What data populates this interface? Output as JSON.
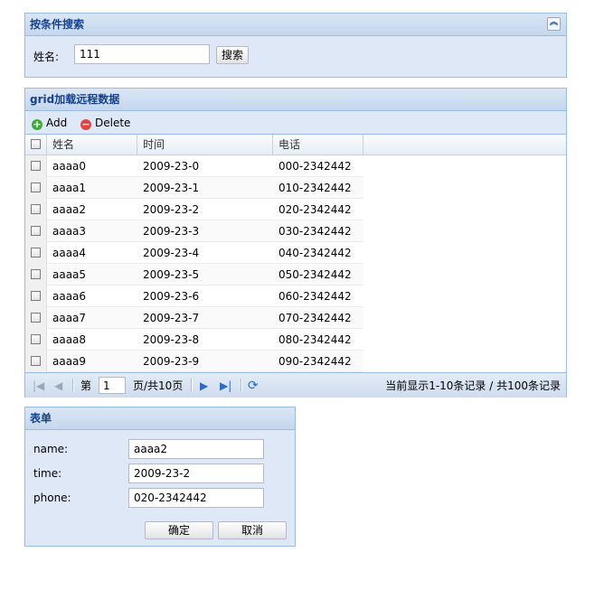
{
  "search_panel": {
    "title": "按条件搜索",
    "name_label": "姓名:",
    "name_value": "111",
    "search_button": "搜索",
    "collapse_icon": "double-chevron-up-icon"
  },
  "grid": {
    "title": "grid加载远程数据",
    "toolbar": {
      "add_label": "Add",
      "delete_label": "Delete",
      "add_icon": "add-icon",
      "delete_icon": "delete-icon"
    },
    "columns": [
      "姓名",
      "时间",
      "电话"
    ],
    "rows": [
      {
        "name": "aaaa0",
        "time": "2009-23-0",
        "phone": "000-2342442"
      },
      {
        "name": "aaaa1",
        "time": "2009-23-1",
        "phone": "010-2342442"
      },
      {
        "name": "aaaa2",
        "time": "2009-23-2",
        "phone": "020-2342442"
      },
      {
        "name": "aaaa3",
        "time": "2009-23-3",
        "phone": "030-2342442"
      },
      {
        "name": "aaaa4",
        "time": "2009-23-4",
        "phone": "040-2342442"
      },
      {
        "name": "aaaa5",
        "time": "2009-23-5",
        "phone": "050-2342442"
      },
      {
        "name": "aaaa6",
        "time": "2009-23-6",
        "phone": "060-2342442"
      },
      {
        "name": "aaaa7",
        "time": "2009-23-7",
        "phone": "070-2342442"
      },
      {
        "name": "aaaa8",
        "time": "2009-23-8",
        "phone": "080-2342442"
      },
      {
        "name": "aaaa9",
        "time": "2009-23-9",
        "phone": "090-2342442"
      }
    ],
    "pager": {
      "page_prefix": "第",
      "page_value": "1",
      "page_suffix": "页/共10页",
      "display_text": "当前显示1-10条记录 / 共100条记录"
    }
  },
  "form": {
    "title": "表单",
    "name_label": "name:",
    "name_value": "aaaa2",
    "time_label": "time:",
    "time_value": "2009-23-2",
    "phone_label": "phone:",
    "phone_value": "020-2342442",
    "ok_button": "确定",
    "cancel_button": "取消"
  },
  "colors": {
    "panel_border": "#99bbe8",
    "panel_bg": "#dfe8f6",
    "header_text": "#15428b",
    "add_green": "#3fa93b",
    "delete_red": "#e04545"
  }
}
